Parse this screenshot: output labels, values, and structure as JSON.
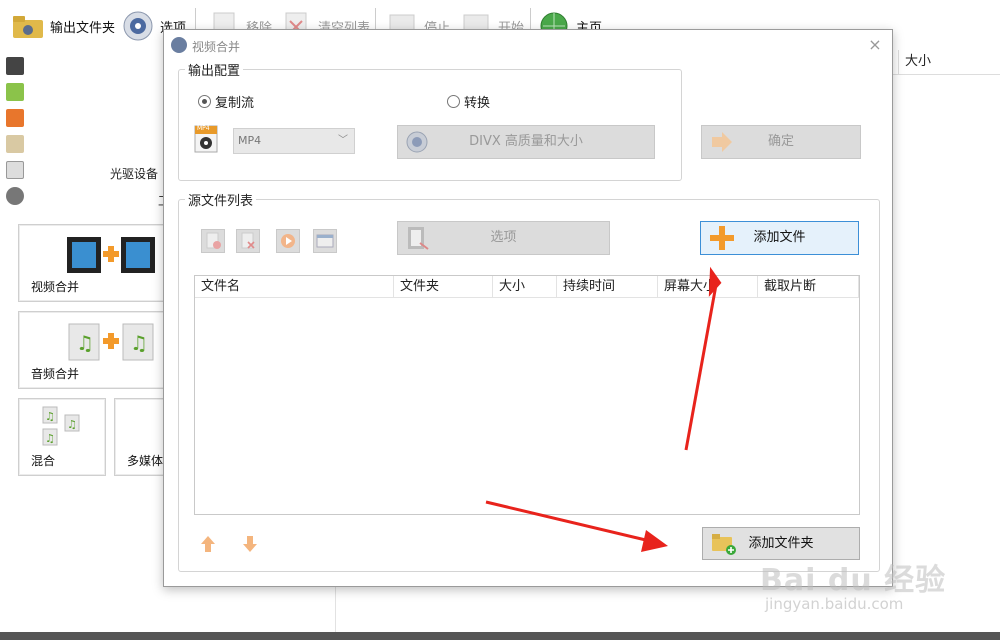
{
  "toolbar": {
    "items": [
      {
        "label": "输出文件夹",
        "icon": "folder-icon"
      },
      {
        "label": "选项",
        "icon": "options-gear-icon"
      },
      {
        "label": "移除",
        "icon": "remove-icon"
      },
      {
        "label": "清空列表",
        "icon": "clear-list-icon"
      },
      {
        "label": "停止",
        "icon": "stop-icon"
      },
      {
        "label": "开始",
        "icon": "start-icon"
      },
      {
        "label": "主页",
        "icon": "globe-icon"
      }
    ]
  },
  "background": {
    "optical_label": "光驱设备",
    "size_header": "大小",
    "tiles": {
      "video_merge": "视频合并",
      "audio_merge": "音频合并",
      "mix": "混合",
      "multimedia": "多媒体"
    }
  },
  "dialog": {
    "title": "视频合并",
    "close_symbol": "×",
    "output_config": {
      "legend": "输出配置",
      "radio_copy_stream": "复制流",
      "radio_convert": "转换",
      "format_value": "MP4",
      "format_icon_text": "MP4",
      "quality_button": "DIVX 高质量和大小",
      "confirm_button": "确定"
    },
    "source_list": {
      "legend": "源文件列表",
      "options_button": "选项",
      "add_file_button": "添加文件",
      "add_folder_button": "添加文件夹",
      "columns": [
        "文件名",
        "文件夹",
        "大小",
        "持续时间",
        "屏幕大小",
        "截取片断"
      ]
    }
  },
  "watermark": {
    "brand": "Bai du 经验",
    "url": "jingyan.baidu.com"
  },
  "colors": {
    "accent_blue": "#3c8fd7",
    "plus_orange": "#f39a2b",
    "annotation_red": "#e8231c"
  }
}
